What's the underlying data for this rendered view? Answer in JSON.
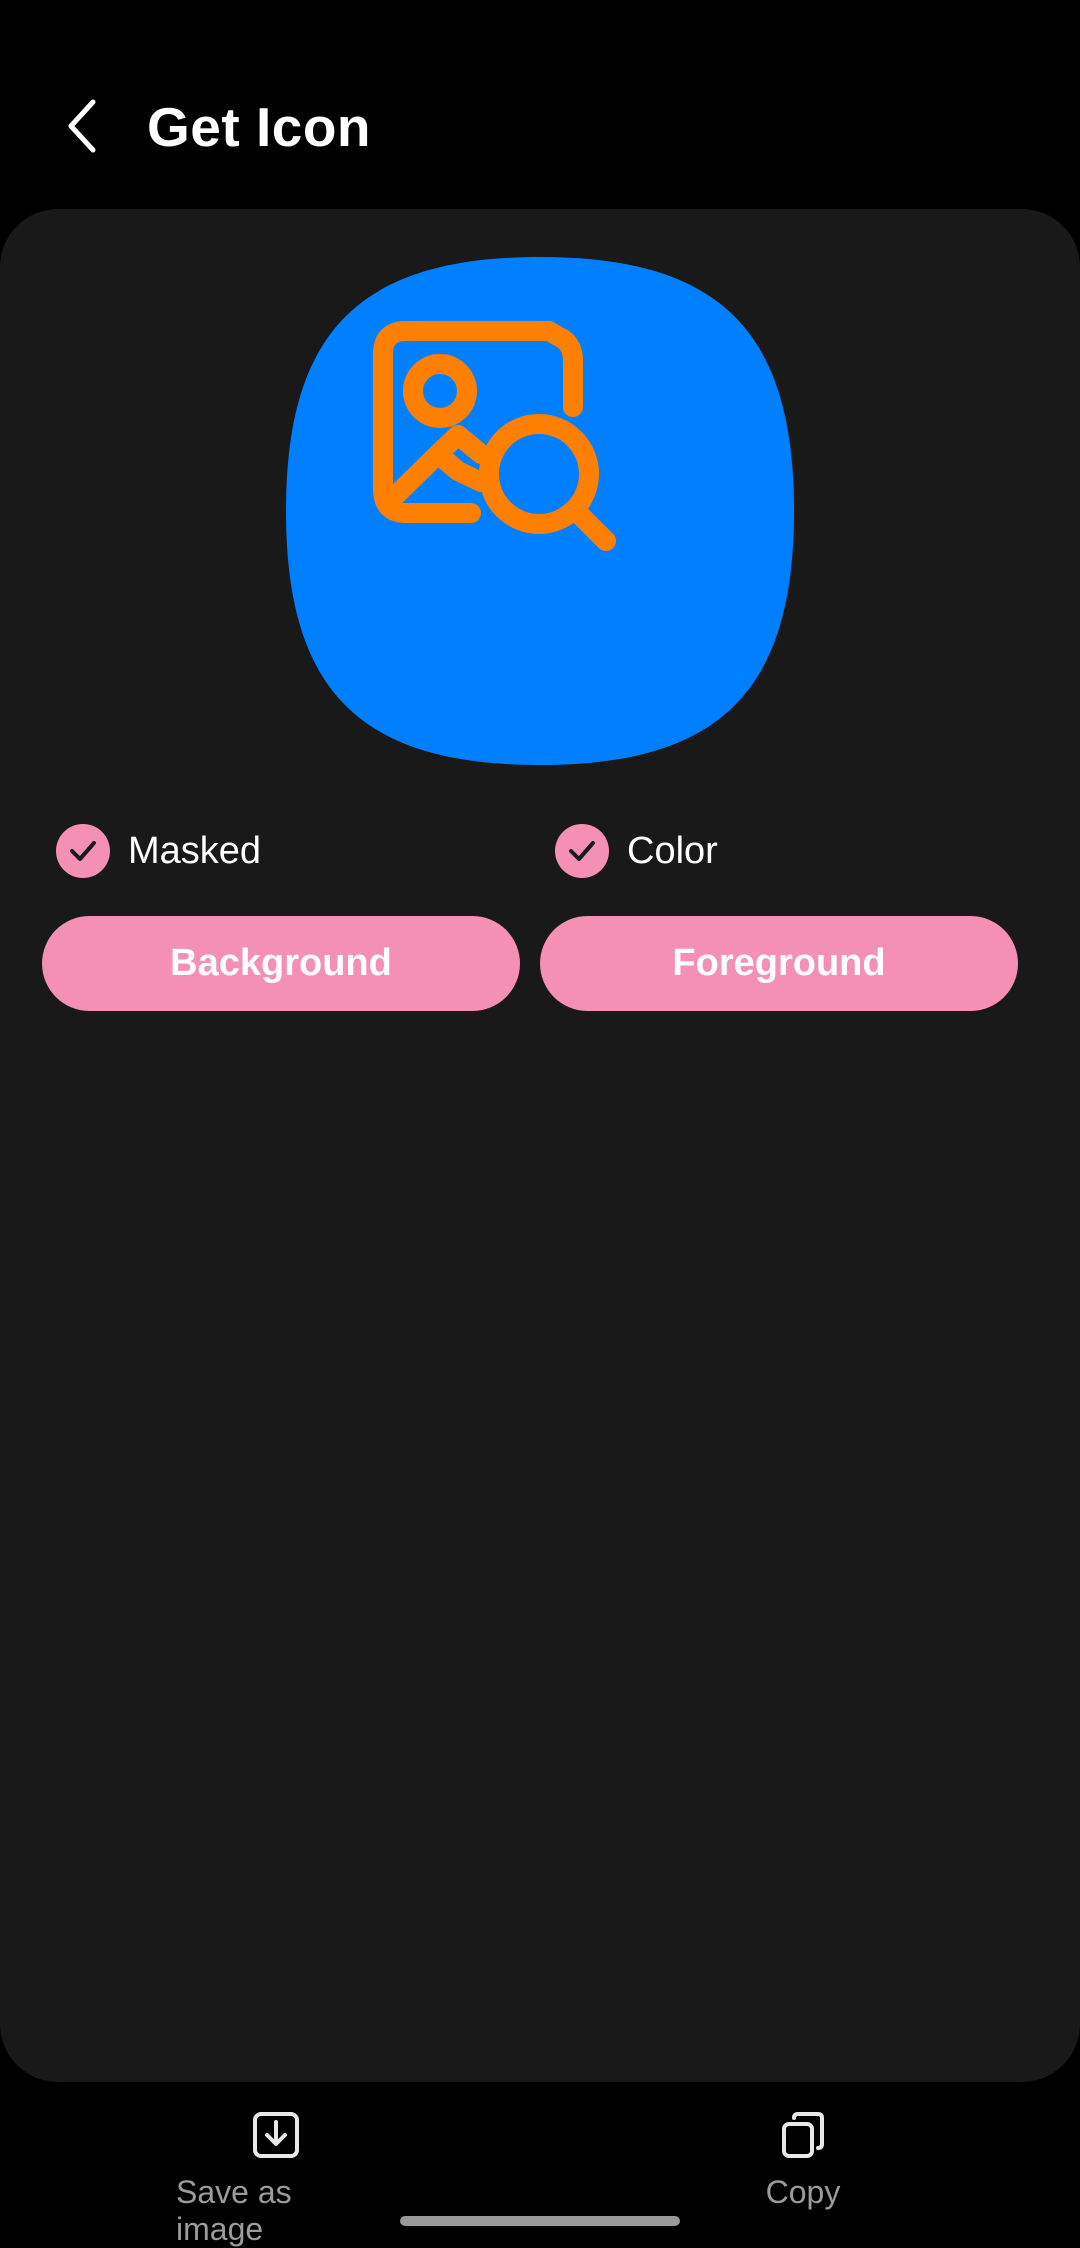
{
  "header": {
    "title": "Get Icon",
    "back_icon": "chevron-left-icon"
  },
  "preview": {
    "icon": "image-search-icon",
    "background_color": "#0080ff",
    "foreground_color": "#ff7f00"
  },
  "options": {
    "masked": {
      "label": "Masked",
      "checked": true
    },
    "color": {
      "label": "Color",
      "checked": true
    }
  },
  "buttons": {
    "background": "Background",
    "foreground": "Foreground"
  },
  "bottom_bar": {
    "save": {
      "label": "Save as image",
      "icon": "download-icon"
    },
    "copy": {
      "label": "Copy",
      "icon": "copy-icon"
    }
  },
  "colors": {
    "accent": "#f490b3",
    "card": "#191919",
    "background": "#000000"
  }
}
